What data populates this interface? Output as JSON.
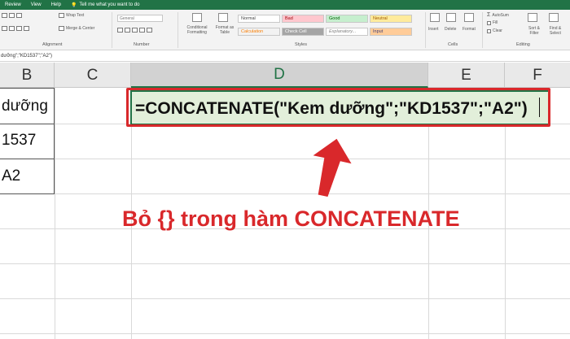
{
  "menu": {
    "tabs": [
      "Review",
      "View",
      "Help"
    ],
    "tell_me": "Tell me what you want to do"
  },
  "ribbon": {
    "alignment": {
      "wrap_text": "Wrap Text",
      "merge_center": "Merge & Center",
      "label": "Alignment"
    },
    "number": {
      "format_value": "General",
      "label": "Number"
    },
    "styles": {
      "conditional_formatting": "Conditional Formatting",
      "format_as_table": "Format as Table",
      "cells": {
        "normal": "Normal",
        "bad": "Bad",
        "good": "Good",
        "neutral": "Neutral",
        "calculation": "Calculation",
        "check_cell": "Check Cell",
        "explanatory": "Explanatory...",
        "input": "Input"
      },
      "label": "Styles"
    },
    "cells": {
      "insert": "Insert",
      "delete": "Delete",
      "format": "Format",
      "label": "Cells"
    },
    "editing": {
      "autosum": "AutoSum",
      "fill": "Fill",
      "clear": "Clear",
      "sort_filter": "Sort & Filter",
      "find_select": "Find & Select",
      "label": "Editing"
    }
  },
  "formula_bar": {
    "text": "dưỡng\";\"KD1537\";\"A2\")"
  },
  "columns": [
    "B",
    "C",
    "D",
    "E",
    "F"
  ],
  "cells": {
    "b1": "dưỡng",
    "b2": "1537",
    "b3": "A2"
  },
  "active_cell": {
    "formula": "=CONCATENATE(\"Kem dưỡng\";\"KD1537\";\"A2\")"
  },
  "caption": "Bỏ {} trong hàm CONCATENATE",
  "colors": {
    "excel_green": "#217346",
    "annotation_red": "#d9282b",
    "active_fill": "#e2efda"
  }
}
